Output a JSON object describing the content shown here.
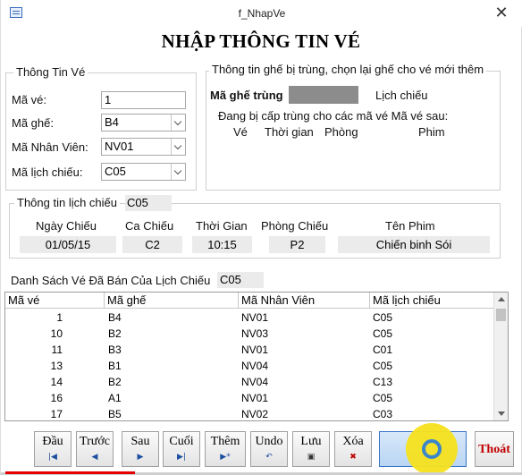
{
  "window": {
    "title": "f_NhapVe"
  },
  "heading": "NHẬP THÔNG TIN VÉ",
  "ticket_info": {
    "legend": "Thông Tin Vé",
    "ma_ve_label": "Mã vé:",
    "ma_ve_value": "1",
    "ma_ghe_label": "Mã ghế:",
    "ma_ghe_value": "B4",
    "ma_nv_label": "Mã Nhân Viên:",
    "ma_nv_value": "NV01",
    "ma_lc_label": "Mã lịch chiếu:",
    "ma_lc_value": "C05"
  },
  "duplicate_info": {
    "legend": "Thông tin ghế bị trùng, chọn lại ghế cho vé mới thêm",
    "seat_label": "Mã ghế trùng",
    "schedule_label": "Lịch chiếu",
    "note": "Đang bị cấp trùng cho các mã vé Mã vé sau:",
    "columns": [
      "Vé",
      "Thời gian",
      "Phòng",
      "Phim"
    ]
  },
  "schedule_info": {
    "legend": "Thông tin lịch chiếu",
    "code": "C05",
    "fields": [
      {
        "label": "Ngày Chiếu",
        "value": "01/05/15"
      },
      {
        "label": "Ca Chiếu",
        "value": "C2"
      },
      {
        "label": "Thời Gian",
        "value": "10:15"
      },
      {
        "label": "Phòng Chiếu",
        "value": "P2"
      },
      {
        "label": "Tên Phim",
        "value": "Chiến binh Sói"
      }
    ]
  },
  "sold_list": {
    "label": "Danh Sách Vé Đã Bán Của Lịch Chiếu",
    "code": "C05",
    "headers": [
      "Mã vé",
      "Mã ghế",
      "Mã Nhân Viên",
      "Mã lịch chiếu"
    ],
    "rows": [
      [
        "1",
        "B4",
        "NV01",
        "C05"
      ],
      [
        "10",
        "B2",
        "NV03",
        "C05"
      ],
      [
        "11",
        "B3",
        "NV01",
        "C01"
      ],
      [
        "13",
        "B1",
        "NV04",
        "C05"
      ],
      [
        "14",
        "B2",
        "NV04",
        "C13"
      ],
      [
        "16",
        "A1",
        "NV01",
        "C05"
      ],
      [
        "17",
        "B5",
        "NV02",
        "C03"
      ]
    ]
  },
  "buttons": {
    "first": "Đầu",
    "prev": "Trước",
    "next": "Sau",
    "last": "Cuối",
    "add": "Thêm",
    "undo": "Undo",
    "save": "Lưu",
    "delete": "Xóa",
    "exit": "Thoát"
  },
  "colors": {
    "exit_text": "#c00000",
    "cursor": "#f5e21e",
    "progress": "#e60000"
  }
}
